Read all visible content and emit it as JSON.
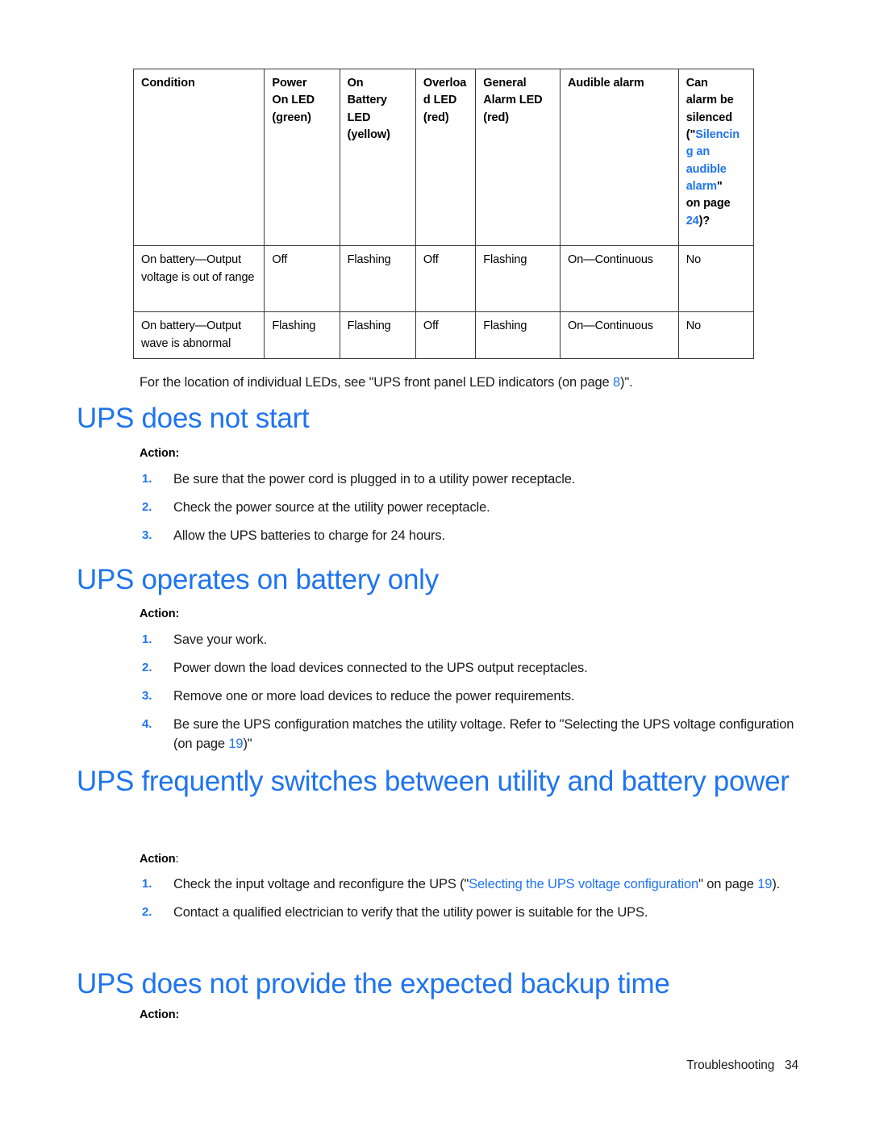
{
  "colors": {
    "heading_blue": "#1f74ef",
    "link_blue": "#1f74ef",
    "body_text": "#1a1a1a",
    "table_border": "#3a3a3a"
  },
  "table": {
    "name": "ups-led-condition-table",
    "columns": [
      "Condition",
      "Power On LED (green)",
      "On Battery LED (yellow)",
      "Overload LED (red)",
      "General Alarm LED (red)",
      "Audible alarm",
      "Can alarm be silenced (\"Silencing an audible alarm\" on page 24)?"
    ],
    "header_cells": [
      {
        "plain": "Condition"
      },
      {
        "l1": "Power",
        "l2": "On LED",
        "l3": "(green)"
      },
      {
        "l1": "On",
        "l2": "Battery",
        "l3": "LED",
        "l4": "(yellow)"
      },
      {
        "l1": "Overloa",
        "l2": "d LED",
        "l3": "(red)"
      },
      {
        "l1": "General",
        "l2": "Alarm LED",
        "l3": "(red)"
      },
      {
        "plain": "Audible alarm"
      },
      {
        "l1": "Can",
        "l2": "alarm be",
        "l3": "silenced",
        "l4_open": "(\"",
        "l4_link": "Silencin",
        "l5_link": "g an",
        "l6_link": "audible",
        "l7_link": "alarm",
        "l7_close": "\"",
        "l8": "on page",
        "l9_link": "24",
        "l9_close": ")?"
      }
    ],
    "rows": [
      {
        "condition": "On battery—Output voltage is out of range",
        "power_on_led": "Off",
        "on_battery_led": "Flashing",
        "overload_led": "Off",
        "general_alarm_led": "Flashing",
        "audible_alarm": "On—Continuous",
        "can_be_silenced": "No"
      },
      {
        "condition": "On battery—Output wave is abnormal",
        "power_on_led": "Flashing",
        "on_battery_led": "Flashing",
        "overload_led": "Off",
        "general_alarm_led": "Flashing",
        "audible_alarm": "On—Continuous",
        "can_be_silenced": "No"
      }
    ]
  },
  "note_leds": {
    "before": "For the location of individual LEDs, see \"UPS front panel LED indicators (on page ",
    "page_link": "8",
    "after": ")\"."
  },
  "sections": [
    {
      "heading": "UPS does not start",
      "action_label": "Action",
      "action_colon": ":",
      "steps": [
        {
          "num": "1.",
          "text": "Be sure that the power cord is plugged in to a utility power receptacle."
        },
        {
          "num": "2.",
          "text": "Check the power source at the utility power receptacle."
        },
        {
          "num": "3.",
          "text": "Allow the UPS batteries to charge for 24 hours."
        }
      ]
    },
    {
      "heading": "UPS operates on battery only",
      "action_label": "Action",
      "action_colon": ":",
      "steps": [
        {
          "num": "1.",
          "text": "Save your work."
        },
        {
          "num": "2.",
          "text": "Power down the load devices connected to the UPS output receptacles."
        },
        {
          "num": "3.",
          "text": "Remove one or more load devices to reduce the power requirements."
        },
        {
          "num": "4.",
          "before": "Be sure the UPS configuration matches the utility voltage. Refer to \"Selecting the UPS voltage configuration (on page ",
          "page_link": "19",
          "after": ")\""
        }
      ]
    },
    {
      "heading": "UPS frequently switches between utility and battery power",
      "action_label": "Action",
      "action_colon": ":",
      "steps": [
        {
          "num": "1.",
          "before": "Check the input voltage and reconfigure the UPS (\"",
          "link": "Selecting the UPS voltage configuration",
          "mid": "\" on page ",
          "page_link": "19",
          "after": ")."
        },
        {
          "num": "2.",
          "text": "Contact a qualified electrician to verify that the utility power is suitable for the UPS."
        }
      ]
    },
    {
      "heading": "UPS does not provide the expected backup time",
      "action_label": "Action",
      "action_colon": ":",
      "steps": []
    }
  ],
  "footer": {
    "chapter": "Troubleshooting",
    "page_number": "34",
    "text": "Troubleshooting   34"
  }
}
